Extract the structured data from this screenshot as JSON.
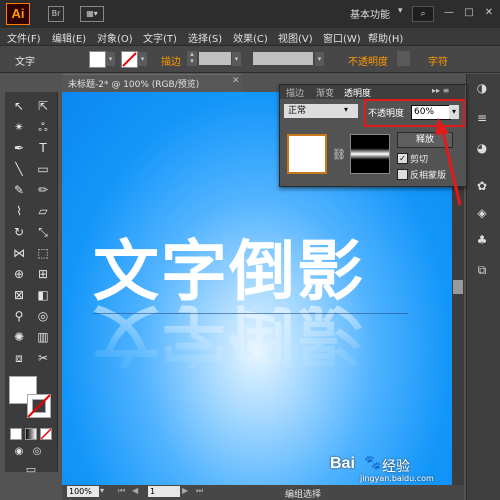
{
  "app": {
    "logo": "Ai",
    "workspace": "基本功能",
    "workspace_arrow": "▾",
    "search_icon": "search-icon",
    "window_controls": [
      "—",
      "□",
      "✕"
    ]
  },
  "menu": [
    "文件(F)",
    "编辑(E)",
    "对象(O)",
    "文字(T)",
    "选择(S)",
    "效果(C)",
    "视图(V)",
    "窗口(W)",
    "帮助(H)"
  ],
  "control_bar": {
    "object_type": "文字",
    "stroke_label": "描边",
    "opacity_label": "不透明度",
    "char_label": "字符"
  },
  "document": {
    "tab_title": "未标题-2* @ 100% (RGB/预览)",
    "close": "✕",
    "artwork_text": "文字倒影"
  },
  "transparency_panel": {
    "tabs": [
      "描边",
      "渐变",
      "透明度"
    ],
    "active_tab": "透明度",
    "blend_mode": "正常",
    "opacity_label": "不透明度",
    "opacity_value": "60%",
    "release_button": "释放",
    "clip_checked": true,
    "clip_label": "剪切",
    "invert_checked": false,
    "invert_label": "反相蒙版",
    "menu_icon": "▸▸ ≡"
  },
  "status_bar": {
    "zoom": "100%",
    "page": "1",
    "text": "编组选择"
  },
  "watermark": {
    "brand": "Bai",
    "brand2": "经验",
    "url": "jingyan.baidu.com"
  },
  "colors": {
    "accent_orange": "#ff9900",
    "annotation_red": "#e21a1a",
    "canvas_blue": "#0a88f2"
  }
}
